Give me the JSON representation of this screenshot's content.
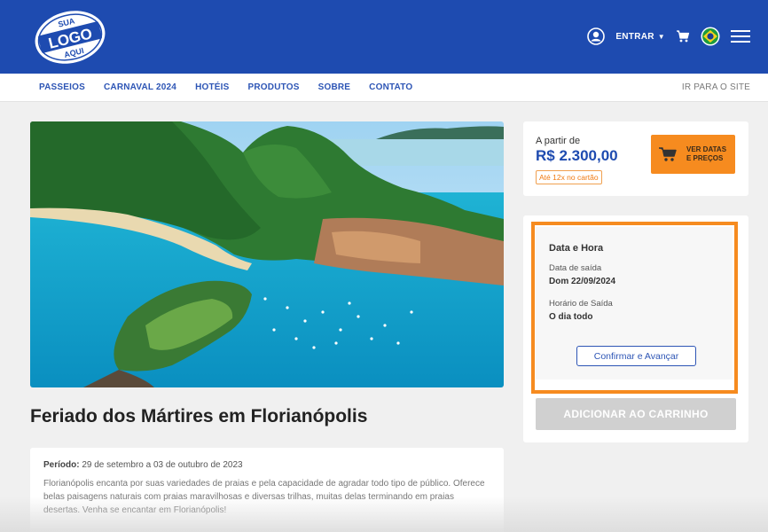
{
  "header": {
    "logo_text": [
      "SUA",
      "LOGO",
      "AQUI"
    ],
    "login_label": "ENTRAR",
    "brand_color": "#1e4bb0",
    "icons": [
      "user-icon",
      "cart-icon",
      "brazil-flag-icon",
      "menu-icon"
    ]
  },
  "nav": {
    "items": [
      "PASSEIOS",
      "CARNAVAL 2024",
      "HOTÉIS",
      "PRODUTOS",
      "SOBRE",
      "CONTATO"
    ],
    "right_link": "IR PARA O SITE"
  },
  "product": {
    "title": "Feriado dos Mártires em Florianópolis",
    "period_label": "Período:",
    "period_value": "29 de setembro a 03 de outubro de 2023",
    "description": "Florianópolis encanta por suas variedades de praias e pela capacidade de agradar todo tipo de público. Oferece belas paisagens naturais com praias maravilhosas e diversas trilhas, muitas delas terminando em praias desertas. Venha se encantar em Florianópolis!"
  },
  "pricing": {
    "from_label": "A partir de",
    "price": "R$ 2.300,00",
    "installments": "Até 12x no cartão",
    "dates_button_line1": "VER DATAS",
    "dates_button_line2": "E PREÇOS",
    "accent_color": "#f68b1f"
  },
  "booking": {
    "section_title": "Data e Hora",
    "departure_date_label": "Data de saída",
    "departure_date_value": "Dom 22/09/2024",
    "departure_time_label": "Horário de Saída",
    "departure_time_value": "O dia todo",
    "confirm_button": "Confirmar e Avançar",
    "add_to_cart_button": "ADICIONAR AO CARRINHO"
  }
}
